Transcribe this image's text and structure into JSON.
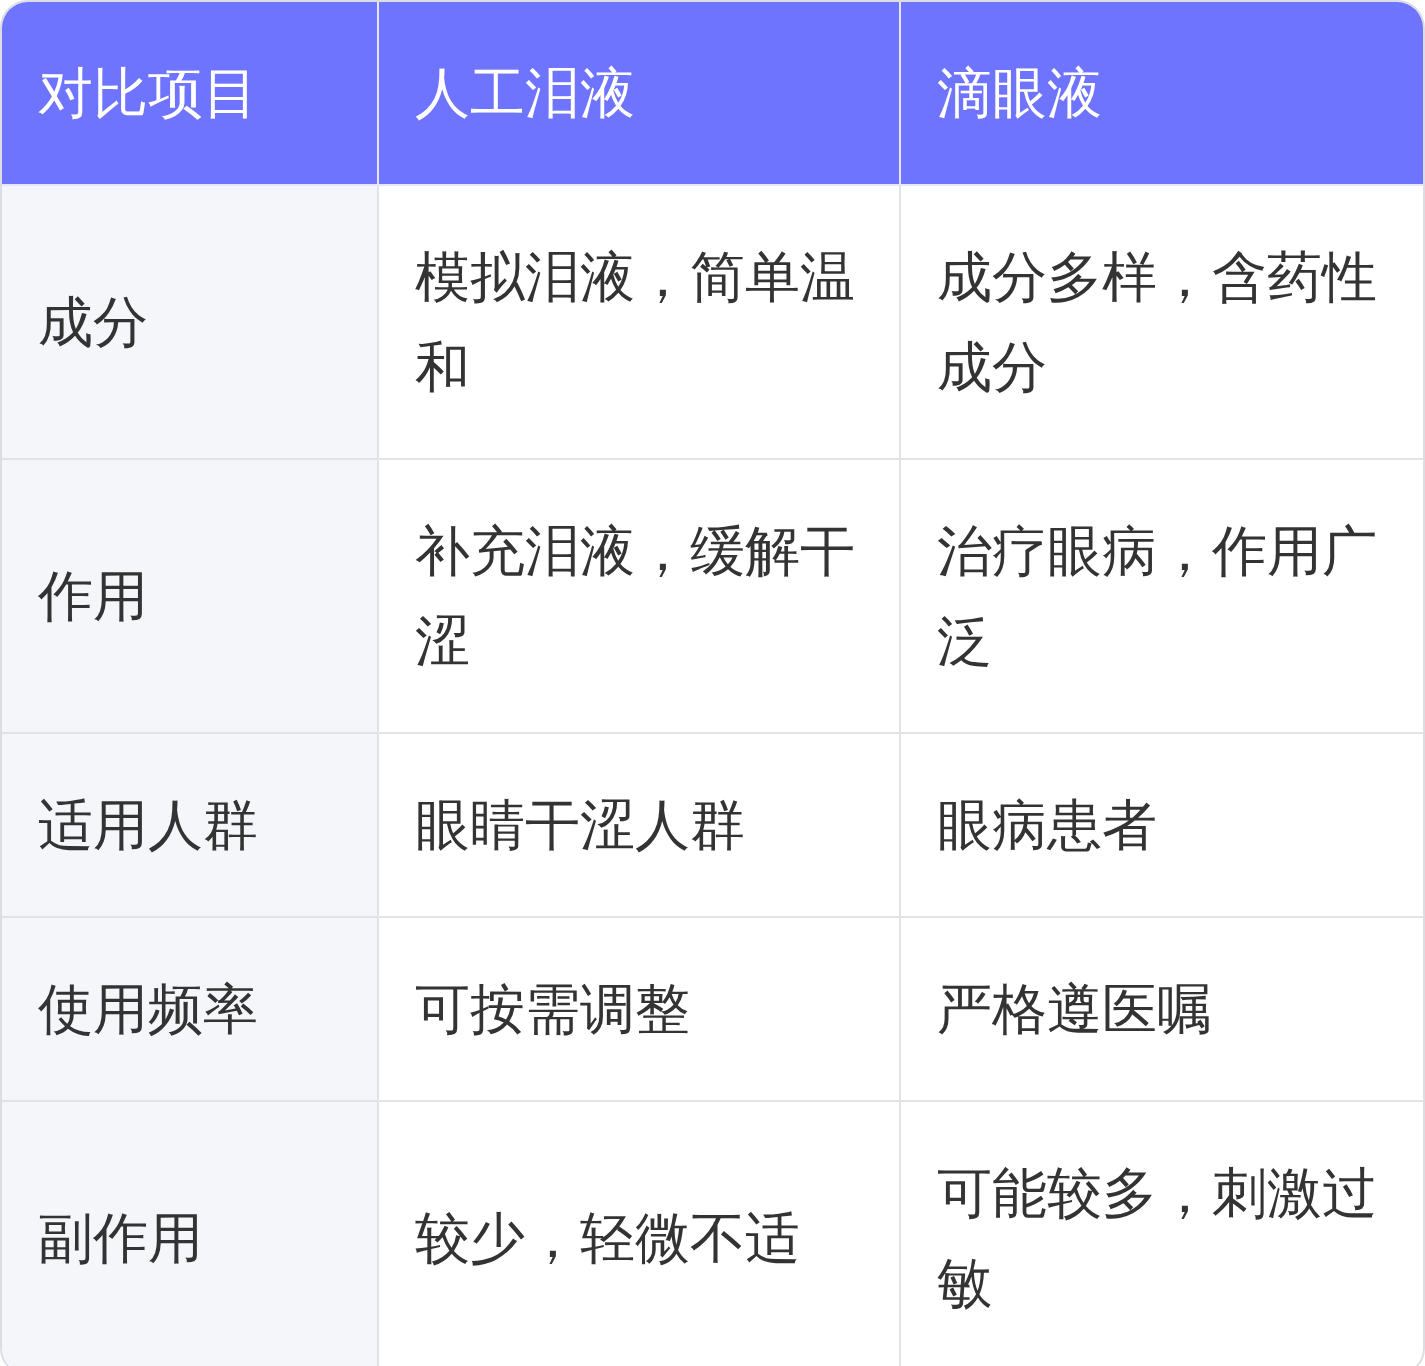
{
  "table": {
    "columns": [
      "对比项目",
      "人工泪液",
      "滴眼液"
    ],
    "rows": [
      [
        "成分",
        "模拟泪液，简单温和",
        "成分多样，含药性成分"
      ],
      [
        "作用",
        "补充泪液，缓解干涩",
        "治疗眼病，作用广泛"
      ],
      [
        "适用人群",
        "眼睛干涩人群",
        "眼病患者"
      ],
      [
        "使用频率",
        "可按需调整",
        "严格遵医嘱"
      ],
      [
        "副作用",
        "较少，轻微不适",
        "可能较多，刺激过敏"
      ]
    ]
  }
}
